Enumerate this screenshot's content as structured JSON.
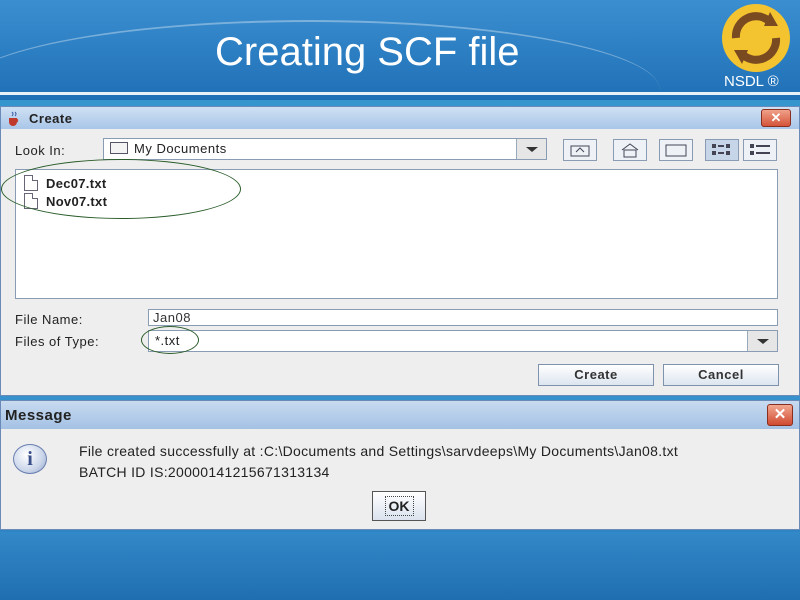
{
  "slide": {
    "title": "Creating SCF file",
    "logo_text": "NSDL ®"
  },
  "create_dialog": {
    "title": "Create",
    "close_label": "✕",
    "look_in_label": "Look In:",
    "look_in_value": "My Documents",
    "files": [
      "Dec07.txt",
      "Nov07.txt"
    ],
    "file_name_label": "File Name:",
    "file_name_value": "Jan08",
    "files_of_type_label": "Files of Type:",
    "files_of_type_value": "*.txt",
    "create_button": "Create",
    "cancel_button": "Cancel",
    "toolbar_icons": [
      "up-folder-icon",
      "home-icon",
      "new-folder-icon",
      "list-view-icon",
      "details-view-icon"
    ]
  },
  "message_dialog": {
    "title": "Message",
    "close_label": "✕",
    "info_glyph": "i",
    "line1": "File created successfully at :C:\\Documents and Settings\\sarvdeeps\\My Documents\\Jan08.txt",
    "line2": "BATCH ID IS:20000141215671313134",
    "ok_button": "OK"
  },
  "colors": {
    "background_blue": "#2f8fc9",
    "annotation_green": "#2b5d2b",
    "close_red": "#d4543a"
  }
}
